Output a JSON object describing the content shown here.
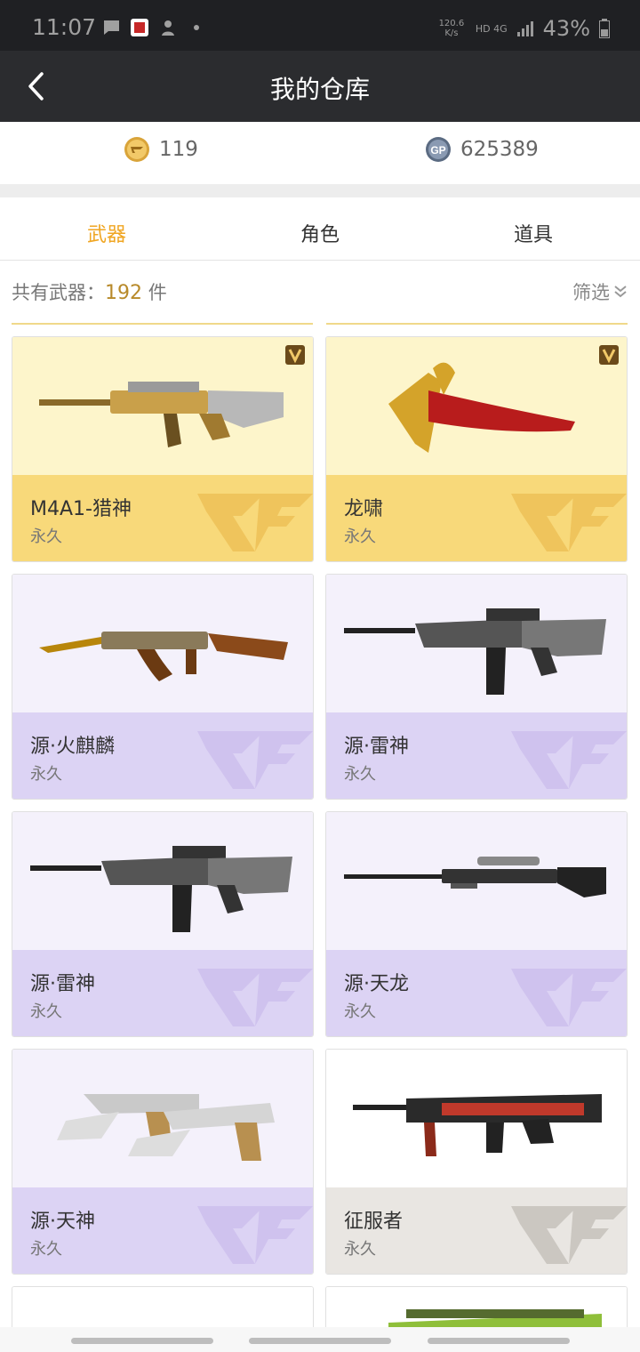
{
  "status_bar": {
    "time": "11:07",
    "speed": "120.6 K/s",
    "network": "HD 4G",
    "battery": "43%"
  },
  "header": {
    "title": "我的仓库",
    "back_icon": "chevron-left-icon"
  },
  "currency": {
    "cf_points": "119",
    "gp_points": "625389",
    "gp_label": "GP"
  },
  "tabs": [
    {
      "label": "武器",
      "active": true
    },
    {
      "label": "角色",
      "active": false
    },
    {
      "label": "道具",
      "active": false
    }
  ],
  "summary": {
    "prefix": "共有武器：",
    "count": "192",
    "unit": "件",
    "filter_label": "筛选"
  },
  "items": [
    {
      "name": "M4A1-猎神",
      "duration": "永久",
      "theme": "gold",
      "weapon_icon": "rifle-icon",
      "badge": "V"
    },
    {
      "name": "龙啸",
      "duration": "永久",
      "theme": "gold",
      "weapon_icon": "axe-icon",
      "badge": "V"
    },
    {
      "name": "源·火麒麟",
      "duration": "永久",
      "theme": "purple",
      "weapon_icon": "ak-rifle-icon"
    },
    {
      "name": "源·雷神",
      "duration": "永久",
      "theme": "purple",
      "weapon_icon": "rifle-icon"
    },
    {
      "name": "源·雷神",
      "duration": "永久",
      "theme": "purple",
      "weapon_icon": "rifle-icon"
    },
    {
      "name": "源·天龙",
      "duration": "永久",
      "theme": "purple",
      "weapon_icon": "sniper-icon"
    },
    {
      "name": "源·天神",
      "duration": "永久",
      "theme": "purple",
      "weapon_icon": "dual-pistol-icon"
    },
    {
      "name": "征服者",
      "duration": "永久",
      "theme": "grey",
      "weapon_icon": "shotgun-icon"
    }
  ],
  "colors": {
    "accent": "#f0a623",
    "gold_bg": "#f8d97a",
    "purple_bg": "#dcd3f4",
    "grey_bg": "#e9e6e2"
  }
}
